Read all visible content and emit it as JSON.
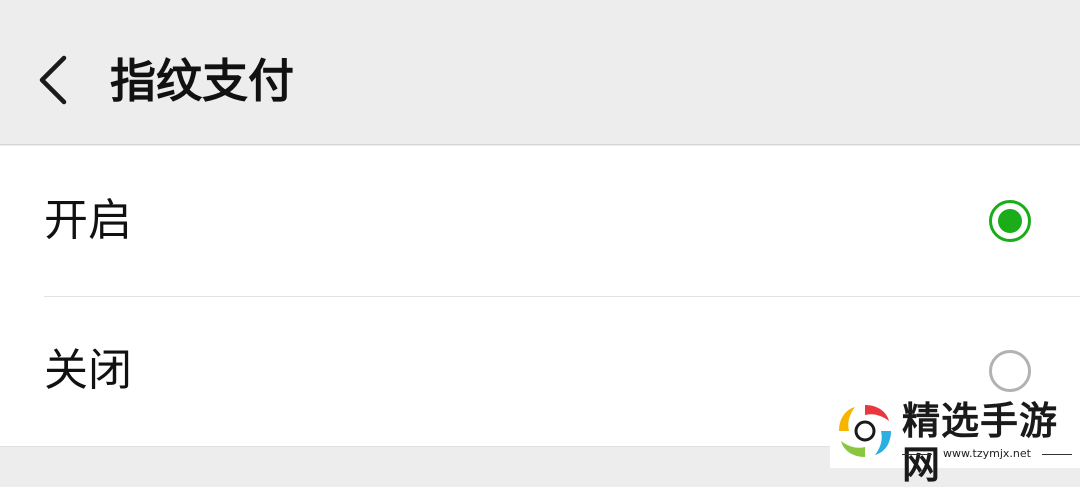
{
  "header": {
    "title": "指纹支付",
    "back_icon": "chevron-left-icon"
  },
  "options": [
    {
      "label": "开启",
      "selected": true
    },
    {
      "label": "关闭",
      "selected": false
    }
  ],
  "colors": {
    "accent": "#1aad19",
    "radio_off": "#b2b2b2",
    "background": "#ededed"
  },
  "watermark": {
    "text": "精选手游网",
    "url": "www.tzymjx.net"
  }
}
